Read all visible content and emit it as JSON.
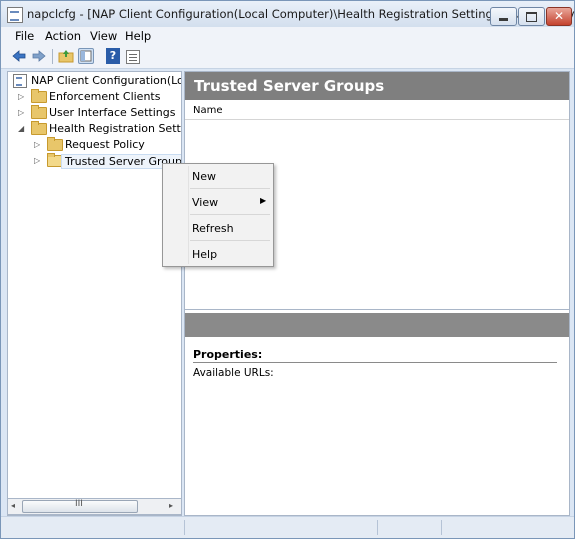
{
  "window": {
    "title": "napclcfg - [NAP Client Configuration(Local Computer)\\Health Registration Settings\\Trusted Server...",
    "controls": {
      "minimize_icon": "minimize-icon",
      "maximize_icon": "maximize-icon",
      "close_label": "✕"
    }
  },
  "menubar": {
    "items": [
      "File",
      "Action",
      "View",
      "Help"
    ]
  },
  "toolbar": {
    "icons": [
      "back-arrow-icon",
      "forward-arrow-icon",
      "up-folder-icon",
      "show-hide-tree-icon",
      "help-icon",
      "export-list-icon"
    ],
    "help_glyph": "?"
  },
  "tree": {
    "items": [
      {
        "label": "NAP Client Configuration(Local",
        "expander": "",
        "icon": "console-icon"
      },
      {
        "label": "Enforcement Clients",
        "expander": "▷",
        "icon": "folder-icon"
      },
      {
        "label": "User Interface Settings",
        "expander": "▷",
        "icon": "folder-icon"
      },
      {
        "label": "Health Registration Settings",
        "expander": "◢",
        "icon": "folder-icon"
      },
      {
        "label": "Request Policy",
        "expander": "▷",
        "icon": "folder-icon"
      },
      {
        "label": "Trusted Server Groups",
        "expander": "▷",
        "icon": "folder-open-icon"
      }
    ]
  },
  "hscroll": {
    "left": "◂",
    "right": "▸",
    "grip": "III"
  },
  "main": {
    "header": "Trusted Server Groups",
    "columns": [
      "Name"
    ],
    "properties_title": "Properties:",
    "properties_field": "Available URLs:"
  },
  "context_menu": {
    "items": [
      {
        "label": "New",
        "submenu": false
      },
      {
        "label": "View",
        "submenu": true,
        "arrow": "▶"
      },
      {
        "label": "Refresh",
        "submenu": false
      },
      {
        "label": "Help",
        "submenu": false
      }
    ]
  },
  "colors": {
    "header_bg": "#7f7f7f",
    "window_frame": "#dbe6f4",
    "folder": "#e8c66a"
  }
}
